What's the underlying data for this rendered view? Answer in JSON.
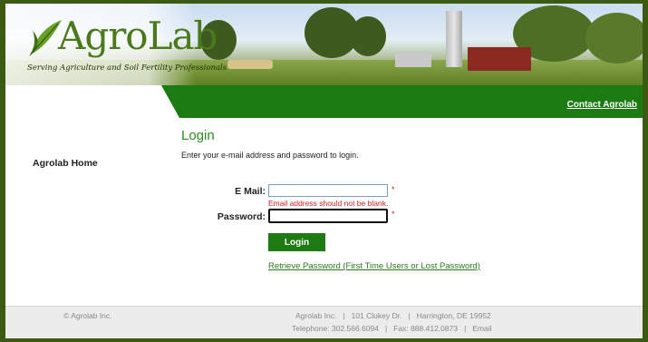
{
  "header": {
    "logo_text": "AgroLab",
    "tagline": "Serving Agriculture and Soil Fertility Professionals",
    "contact_link": "Contact Agrolab"
  },
  "sidebar": {
    "home_link": "Agrolab Home"
  },
  "login": {
    "title": "Login",
    "intro": "Enter your e-mail address and password to login.",
    "email_label": "E Mail:",
    "email_value": "",
    "email_error": "Email address should not be blank.",
    "password_label": "Password:",
    "password_value": "",
    "required_marker": "*",
    "button_label": "Login",
    "retrieve_link": "Retrieve Password (First Time Users or Lost Password)"
  },
  "footer": {
    "copyright": "© Agrolab Inc.",
    "company": "Agrolab Inc.",
    "address": "101 Clukey Dr.",
    "city": "Harrington, DE 19952",
    "telephone": "Telephone: 302.566.6094",
    "fax": "Fax: 888.412.0873",
    "email": "Email"
  },
  "colors": {
    "accent_green": "#1b7a12",
    "error_red": "#d02020",
    "frame_green": "#3c5a12"
  }
}
